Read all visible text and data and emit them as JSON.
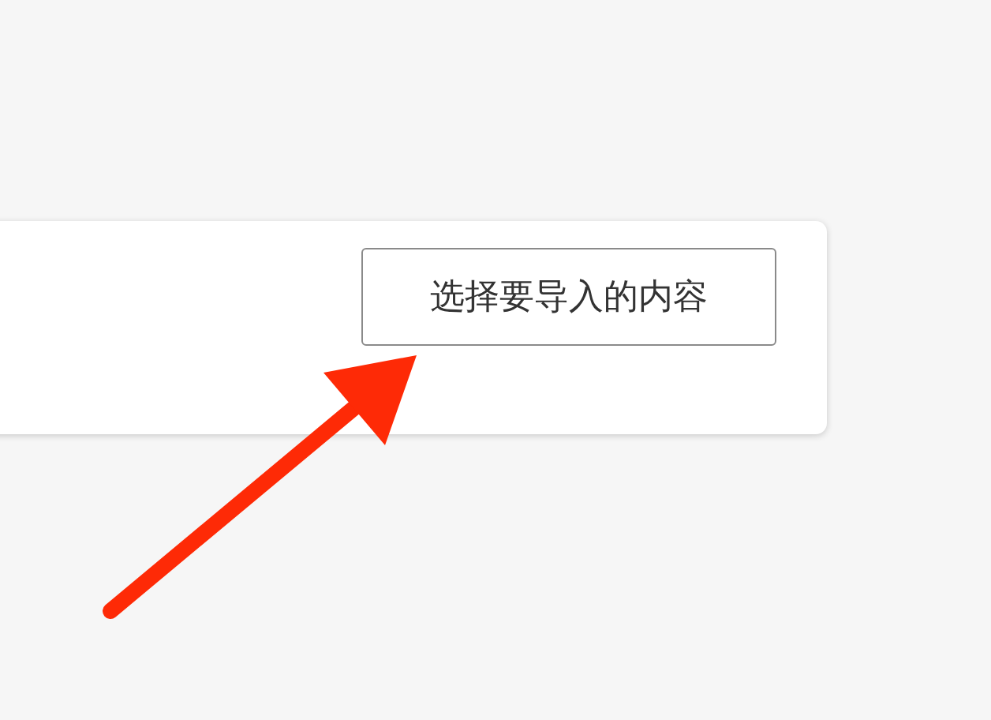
{
  "card": {
    "import_button": {
      "label": "选择要导入的内容"
    }
  }
}
